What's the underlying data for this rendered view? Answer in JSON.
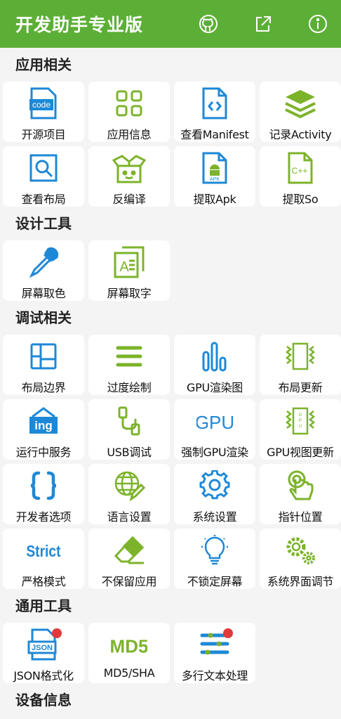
{
  "app": {
    "title": "开发助手专业版",
    "accent": "#5caf36",
    "actions": [
      "github-icon",
      "share-icon",
      "info-icon"
    ]
  },
  "sections": [
    {
      "title": "应用相关",
      "items": [
        {
          "label": "开源项目",
          "icon": "code-file-icon"
        },
        {
          "label": "应用信息",
          "icon": "grid-apps-icon"
        },
        {
          "label": "查看Manifest",
          "icon": "manifest-file-icon"
        },
        {
          "label": "记录Activity",
          "icon": "layers-icon"
        },
        {
          "label": "查看布局",
          "icon": "layout-inspect-icon"
        },
        {
          "label": "反编译",
          "icon": "open-box-icon"
        },
        {
          "label": "提取Apk",
          "icon": "apk-file-icon"
        },
        {
          "label": "提取So",
          "icon": "cpp-file-icon"
        }
      ]
    },
    {
      "title": "设计工具",
      "items": [
        {
          "label": "屏幕取色",
          "icon": "dropper-icon"
        },
        {
          "label": "屏幕取字",
          "icon": "text-capture-icon"
        }
      ]
    },
    {
      "title": "调试相关",
      "items": [
        {
          "label": "布局边界",
          "icon": "layout-bounds-icon"
        },
        {
          "label": "过度绘制",
          "icon": "menu-lines-icon"
        },
        {
          "label": "GPU渲染图",
          "icon": "bar-chart-icon"
        },
        {
          "label": "布局更新",
          "icon": "layout-update-icon"
        },
        {
          "label": "运行中服务",
          "icon": "ing-icon"
        },
        {
          "label": "USB调试",
          "icon": "usb-icon"
        },
        {
          "label": "强制GPU渲染",
          "icon": "gpu-text-icon"
        },
        {
          "label": "GPU视图更新",
          "icon": "gpu-chip-icon"
        },
        {
          "label": "开发者选项",
          "icon": "braces-icon"
        },
        {
          "label": "语言设置",
          "icon": "globe-edit-icon"
        },
        {
          "label": "系统设置",
          "icon": "gear-icon"
        },
        {
          "label": "指针位置",
          "icon": "touch-pointer-icon"
        },
        {
          "label": "严格模式",
          "icon": "strict-icon"
        },
        {
          "label": "不保留应用",
          "icon": "eraser-icon"
        },
        {
          "label": "不锁定屏幕",
          "icon": "bulb-icon"
        },
        {
          "label": "系统界面调节",
          "icon": "gears-icon"
        }
      ]
    },
    {
      "title": "通用工具",
      "items": [
        {
          "label": "JSON格式化",
          "icon": "json-file-icon",
          "badge": true
        },
        {
          "label": "MD5/SHA",
          "icon": "md5-icon"
        },
        {
          "label": "多行文本处理",
          "icon": "multiline-text-icon",
          "badge": true
        }
      ]
    },
    {
      "title": "设备信息",
      "items": []
    }
  ],
  "icon_texts": {
    "code": "code",
    "ing": "ing",
    "gpu": "GPU",
    "strict": "Strict",
    "json": "JSON",
    "md5": "MD5",
    "apk": "APK",
    "cpp": "C++",
    "a": "A"
  },
  "colors": {
    "blue": "#1e88d6",
    "green": "#7cb32a",
    "badge": "#e23a3a"
  }
}
